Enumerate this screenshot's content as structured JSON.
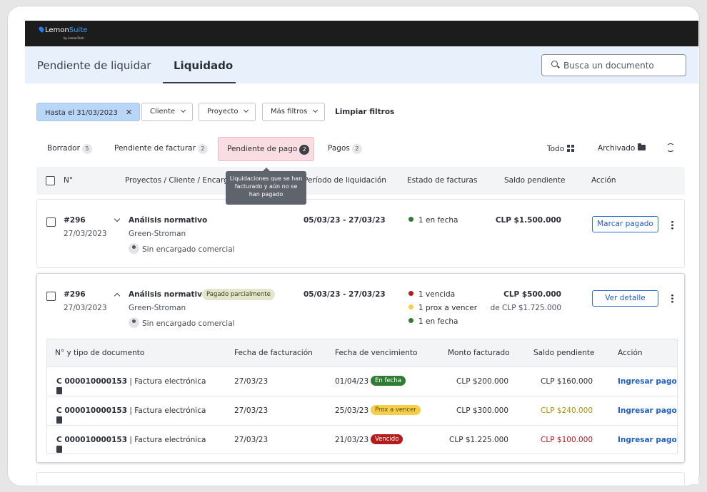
{
  "brand": {
    "name_a": "Lemon",
    "name_b": "Suite",
    "by": "by LemonTech"
  },
  "tabs": [
    {
      "label": "Pendiente de liquidar"
    },
    {
      "label": "Liquidado"
    }
  ],
  "search": {
    "placeholder": "Busca un documento"
  },
  "filters": {
    "date_chip": "Hasta el 31/03/2023",
    "client": "Cliente",
    "project": "Proyecto",
    "more": "Más filtros",
    "clear": "Limpiar filtros"
  },
  "subtabs": [
    {
      "label": "Borrador",
      "count": "5"
    },
    {
      "label": "Pendiente de facturar",
      "count": "2"
    },
    {
      "label": "Pendiente de pago",
      "count": "2"
    },
    {
      "label": "Pagos",
      "count": "2"
    }
  ],
  "views": {
    "all": "Todo",
    "archived": "Archivado"
  },
  "tooltip": "Liquidaciones que se han facturado y aún no se han pagado",
  "table_header": {
    "number": "N°",
    "projects": "Proyectos / Cliente / Encargado",
    "period": "Período de liquidación",
    "invoice_status": "Estado de facturas",
    "balance": "Saldo pendiente",
    "action": "Acción"
  },
  "rows": [
    {
      "id": "#296",
      "date": "27/03/2023",
      "project": "Análisis normativo",
      "client": "Green-Stroman",
      "manager": "Sin encargado comercial",
      "period": "05/03/23 - 27/03/23",
      "status": [
        "1 en fecha"
      ],
      "amount": "CLP $1.500.000",
      "action": "Marcar pagado"
    },
    {
      "id": "#296",
      "date": "27/03/2023",
      "project": "Análisis normativo",
      "tag": "Pagado parcialmente",
      "client": "Green-Stroman",
      "manager": "Sin encargado comercial",
      "period": "05/03/23 - 27/03/23",
      "status": [
        "1 vencida",
        "1 prox a vencer",
        "1 en fecha"
      ],
      "amount": "CLP $500.000",
      "amount_sub": "de CLP $1.725.000",
      "action": "Ver detalle"
    }
  ],
  "sub_header": {
    "doc": "N° y tipo de documento",
    "billing_date": "Fecha de facturación",
    "due_date": "Fecha de vencimiento",
    "billed": "Monto facturado",
    "balance": "Saldo pendiente",
    "action": "Acción"
  },
  "sub_rows": [
    {
      "doc_no": "C 000010000153",
      "doc_type": "| Factura electrónica",
      "billing": "27/03/23",
      "due": "01/04/23",
      "pill": "En fecha",
      "billed": "CLP $200.000",
      "balance": "CLP $160.000",
      "action": "Ingresar pago"
    },
    {
      "doc_no": "C 000010000153",
      "doc_type": "| Factura electrónica",
      "billing": "27/03/23",
      "due": "25/03/23",
      "pill": "Prox a vencer",
      "billed": "CLP $300.000",
      "balance": "CLP $240.000",
      "action": "Ingresar pago"
    },
    {
      "doc_no": "C 000010000153",
      "doc_type": "| Factura electrónica",
      "billing": "27/03/23",
      "due": "21/03/23",
      "pill": "Vencido",
      "billed": "CLP $1.225.000",
      "balance": "CLP $100.000",
      "action": "Ingresar pago"
    }
  ],
  "colors": {
    "green": "#2e7d32",
    "yellow": "#f6cf4a",
    "red": "#b71c1c",
    "link": "#1e5fc8"
  }
}
